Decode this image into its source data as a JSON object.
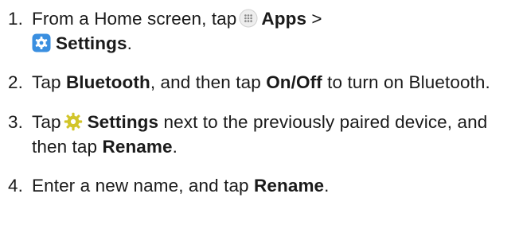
{
  "steps": [
    {
      "number": "1.",
      "parts": {
        "t1": "From a Home screen, tap",
        "b1": "Apps",
        "t2": " >",
        "b2": "Settings",
        "t3": "."
      },
      "icons": [
        "apps-icon",
        "settings-icon"
      ]
    },
    {
      "number": "2.",
      "parts": {
        "t1": "Tap ",
        "b1": "Bluetooth",
        "t2": ", and then tap ",
        "b2": "On/Off",
        "t3": " to turn on Bluetooth."
      }
    },
    {
      "number": "3.",
      "parts": {
        "t1": "Tap",
        "b1": "Settings",
        "t2": " next to the previously paired device, and then tap ",
        "b2": "Rename",
        "t3": "."
      },
      "icons": [
        "gear-icon"
      ]
    },
    {
      "number": "4.",
      "parts": {
        "t1": "Enter a new name, and tap ",
        "b1": "Rename",
        "t2": "."
      }
    }
  ],
  "colors": {
    "text": "#1a1a1a",
    "settings_blue": "#3a8fe0",
    "gear_gold": "#d2c52a",
    "apps_bg": "#eeeeee"
  }
}
